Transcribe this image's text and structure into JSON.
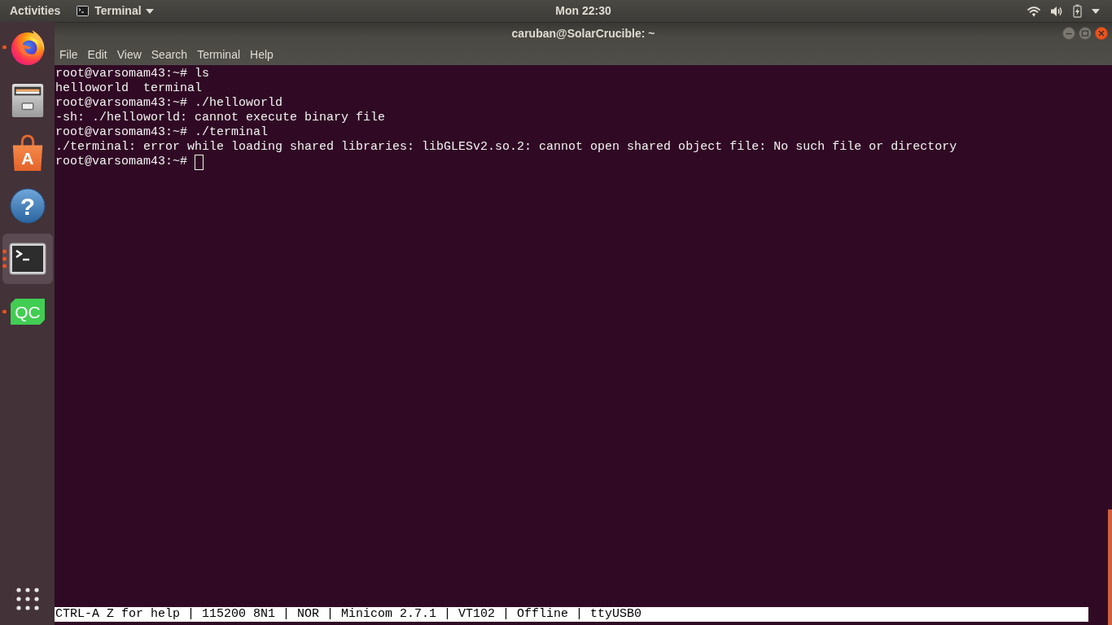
{
  "top_bar": {
    "activities": "Activities",
    "app_menu": "Terminal",
    "clock": "Mon 22:30"
  },
  "dock": {
    "items": [
      {
        "kind": "browser",
        "running": true,
        "several_windows": false,
        "selected": false
      },
      {
        "kind": "files",
        "running": false,
        "selected": false
      },
      {
        "kind": "store",
        "label": "A",
        "running": false,
        "selected": false
      },
      {
        "kind": "help",
        "label": "?",
        "running": false,
        "selected": false
      },
      {
        "kind": "terminal",
        "running": true,
        "several_windows": true,
        "selected": true
      },
      {
        "kind": "ide",
        "label": "QC",
        "running": true,
        "several_windows": false,
        "selected": false
      }
    ]
  },
  "window": {
    "title": "caruban@SolarCrucible: ~",
    "menu": [
      "File",
      "Edit",
      "View",
      "Search",
      "Terminal",
      "Help"
    ]
  },
  "terminal": {
    "lines": [
      "root@varsomam43:~# ls",
      "helloworld  terminal",
      "root@varsomam43:~# ./helloworld",
      "-sh: ./helloworld: cannot execute binary file",
      "root@varsomam43:~# ./terminal",
      "./terminal: error while loading shared libraries: libGLESv2.so.2: cannot open shared object file: No such file or directory"
    ],
    "prompt": "root@varsomam43:~#",
    "cursor": true
  },
  "status_line": "CTRL-A Z for help | 115200 8N1 | NOR | Minicom 2.7.1 | VT102 | Offline | ttyUSB0"
}
